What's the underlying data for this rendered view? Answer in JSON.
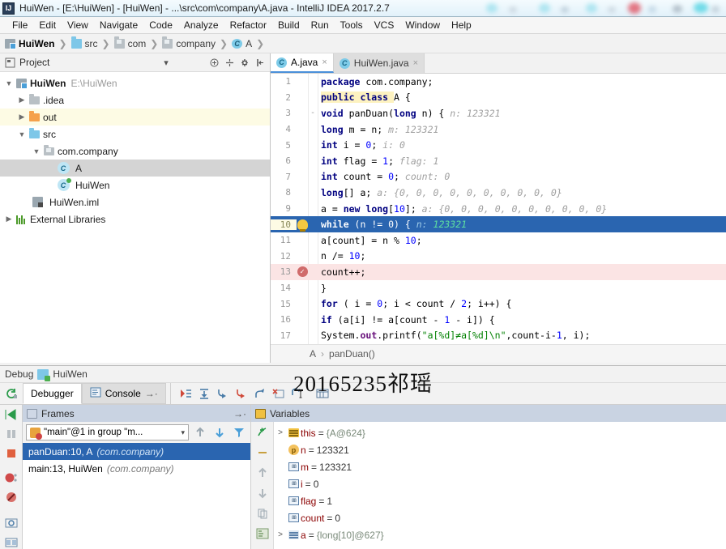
{
  "window": {
    "title": "HuiWen - [E:\\HuiWen] - [HuiWen] - ...\\src\\com\\company\\A.java - IntelliJ IDEA 2017.2.7",
    "app_icon": "IJ"
  },
  "menubar": {
    "items": [
      "File",
      "Edit",
      "View",
      "Navigate",
      "Code",
      "Analyze",
      "Refactor",
      "Build",
      "Run",
      "Tools",
      "VCS",
      "Window",
      "Help"
    ]
  },
  "breadcrumb": {
    "items": [
      {
        "label": "HuiWen",
        "icon": "module-icon"
      },
      {
        "label": "src",
        "icon": "folder-blue-icon"
      },
      {
        "label": "com",
        "icon": "folder-gray-icon"
      },
      {
        "label": "company",
        "icon": "folder-gray-icon"
      },
      {
        "label": "A",
        "icon": "class-icon"
      }
    ]
  },
  "project_panel": {
    "title": "Project",
    "icons": [
      "collapse-all-icon",
      "expand-icon",
      "settings-gear-icon",
      "hide-icon",
      "dropdown-caret-icon"
    ],
    "tree": [
      {
        "label": "HuiWen",
        "sublabel": "E:\\HuiWen",
        "indent": 0,
        "arrow": "v",
        "icon": "module-icon",
        "bold": true,
        "state": "normal"
      },
      {
        "label": ".idea",
        "sublabel": "",
        "indent": 1,
        "arrow": ">",
        "icon": "folder-gray-icon",
        "bold": false,
        "state": "normal"
      },
      {
        "label": "out",
        "sublabel": "",
        "indent": 1,
        "arrow": ">",
        "icon": "folder-orange-icon",
        "bold": false,
        "state": "highlight"
      },
      {
        "label": "src",
        "sublabel": "",
        "indent": 1,
        "arrow": "v",
        "icon": "folder-blue-icon",
        "bold": false,
        "state": "normal"
      },
      {
        "label": "com.company",
        "sublabel": "",
        "indent": 2,
        "arrow": "v",
        "icon": "package-icon",
        "bold": false,
        "state": "normal"
      },
      {
        "label": "A",
        "sublabel": "",
        "indent": 3,
        "arrow": "",
        "icon": "class-icon",
        "bold": false,
        "state": "selected"
      },
      {
        "label": "HuiWen",
        "sublabel": "",
        "indent": 3,
        "arrow": "",
        "icon": "class-run-icon",
        "bold": false,
        "state": "normal"
      },
      {
        "label": "HuiWen.iml",
        "sublabel": "",
        "indent": 1,
        "arrow": "",
        "icon": "iml-file-icon",
        "bold": false,
        "state": "normal"
      },
      {
        "label": "External Libraries",
        "sublabel": "",
        "indent": 0,
        "arrow": ">",
        "icon": "library-icon",
        "bold": false,
        "state": "normal"
      }
    ]
  },
  "editor": {
    "tabs": [
      {
        "label": "A.java",
        "active": true,
        "close": "×",
        "icon": "class-icon"
      },
      {
        "label": "HuiWen.java",
        "active": false,
        "close": "×",
        "icon": "class-run-icon"
      }
    ],
    "breadcrumb": [
      "A",
      "panDuan()"
    ],
    "breadcrumb_sep": "›",
    "lines": [
      {
        "n": "1",
        "fold": "",
        "mark": "",
        "state": "normal",
        "tokens": [
          {
            "t": "package ",
            "c": "kw"
          },
          {
            "t": "com.company;",
            "c": "plain"
          }
        ]
      },
      {
        "n": "2",
        "fold": "",
        "mark": "",
        "state": "normal",
        "tokens": [
          {
            "t": "public class ",
            "c": "kw hl-pub"
          },
          {
            "t": "A {",
            "c": "plain"
          }
        ]
      },
      {
        "n": "3",
        "fold": "-",
        "mark": "",
        "state": "normal",
        "tokens": [
          {
            "t": "    ",
            "c": "plain"
          },
          {
            "t": "void ",
            "c": "kw"
          },
          {
            "t": "panDuan(",
            "c": "plain"
          },
          {
            "t": "long ",
            "c": "kw"
          },
          {
            "t": "n) {",
            "c": "plain"
          },
          {
            "t": "   n:",
            "c": "hint"
          },
          {
            "t": " 123321",
            "c": "hint"
          }
        ]
      },
      {
        "n": "4",
        "fold": "",
        "mark": "",
        "state": "normal",
        "tokens": [
          {
            "t": "        ",
            "c": "plain"
          },
          {
            "t": "long ",
            "c": "kw"
          },
          {
            "t": "m = n;",
            "c": "plain"
          },
          {
            "t": "   m:",
            "c": "hint"
          },
          {
            "t": " 123321",
            "c": "hint"
          }
        ]
      },
      {
        "n": "5",
        "fold": "",
        "mark": "",
        "state": "normal",
        "tokens": [
          {
            "t": "        ",
            "c": "plain"
          },
          {
            "t": "int ",
            "c": "kw"
          },
          {
            "t": "i = ",
            "c": "plain"
          },
          {
            "t": "0",
            "c": "num"
          },
          {
            "t": ";",
            "c": "plain"
          },
          {
            "t": "   i:",
            "c": "hint"
          },
          {
            "t": " 0",
            "c": "hint"
          }
        ]
      },
      {
        "n": "6",
        "fold": "",
        "mark": "",
        "state": "normal",
        "tokens": [
          {
            "t": "        ",
            "c": "plain"
          },
          {
            "t": "int ",
            "c": "kw"
          },
          {
            "t": "flag = ",
            "c": "plain"
          },
          {
            "t": "1",
            "c": "num"
          },
          {
            "t": ";",
            "c": "plain"
          },
          {
            "t": "   flag:",
            "c": "hint"
          },
          {
            "t": " 1",
            "c": "hint"
          }
        ]
      },
      {
        "n": "7",
        "fold": "",
        "mark": "",
        "state": "normal",
        "tokens": [
          {
            "t": "        ",
            "c": "plain"
          },
          {
            "t": "int ",
            "c": "kw"
          },
          {
            "t": "count = ",
            "c": "plain"
          },
          {
            "t": "0",
            "c": "num"
          },
          {
            "t": ";",
            "c": "plain"
          },
          {
            "t": "   count:",
            "c": "hint"
          },
          {
            "t": " 0",
            "c": "hint"
          }
        ]
      },
      {
        "n": "8",
        "fold": "",
        "mark": "",
        "state": "normal",
        "tokens": [
          {
            "t": "        ",
            "c": "plain"
          },
          {
            "t": "long",
            "c": "kw"
          },
          {
            "t": "[] a;",
            "c": "plain"
          },
          {
            "t": "   a:",
            "c": "hint"
          },
          {
            "t": " {0, 0, 0, 0, 0, 0, 0, 0, 0, 0}",
            "c": "hint"
          }
        ]
      },
      {
        "n": "9",
        "fold": "",
        "mark": "",
        "state": "normal",
        "tokens": [
          {
            "t": "        a = ",
            "c": "plain"
          },
          {
            "t": "new long",
            "c": "kw"
          },
          {
            "t": "[",
            "c": "plain"
          },
          {
            "t": "10",
            "c": "num"
          },
          {
            "t": "];",
            "c": "plain"
          },
          {
            "t": "   a:",
            "c": "hint"
          },
          {
            "t": " {0, 0, 0, 0, 0, 0, 0, 0, 0, 0}",
            "c": "hint"
          }
        ]
      },
      {
        "n": "10",
        "fold": "",
        "mark": "bulb",
        "state": "current",
        "tokens": [
          {
            "t": "        ",
            "c": "plain"
          },
          {
            "t": "while ",
            "c": "kw"
          },
          {
            "t": "(n != ",
            "c": "plain"
          },
          {
            "t": "0",
            "c": "num"
          },
          {
            "t": ") {",
            "c": "plain"
          },
          {
            "t": "   n:",
            "c": "hint"
          },
          {
            "t": " 123321",
            "c": "hintv"
          }
        ]
      },
      {
        "n": "11",
        "fold": "",
        "mark": "",
        "state": "normal",
        "tokens": [
          {
            "t": "            a[count] = n % ",
            "c": "plain"
          },
          {
            "t": "10",
            "c": "num"
          },
          {
            "t": ";",
            "c": "plain"
          }
        ]
      },
      {
        "n": "12",
        "fold": "",
        "mark": "",
        "state": "normal",
        "tokens": [
          {
            "t": "            n /= ",
            "c": "plain"
          },
          {
            "t": " 10",
            "c": "num"
          },
          {
            "t": ";",
            "c": "plain"
          }
        ]
      },
      {
        "n": "13",
        "fold": "",
        "mark": "breakpoint",
        "state": "breakpoint",
        "tokens": [
          {
            "t": "            count++;",
            "c": "plain"
          }
        ]
      },
      {
        "n": "14",
        "fold": "",
        "mark": "",
        "state": "normal",
        "tokens": [
          {
            "t": "        }",
            "c": "plain"
          }
        ]
      },
      {
        "n": "15",
        "fold": "",
        "mark": "",
        "state": "normal",
        "tokens": [
          {
            "t": "        ",
            "c": "plain"
          },
          {
            "t": "for ",
            "c": "kw"
          },
          {
            "t": "( i = ",
            "c": "plain"
          },
          {
            "t": "0",
            "c": "num"
          },
          {
            "t": "; i < count / ",
            "c": "plain"
          },
          {
            "t": "2",
            "c": "num"
          },
          {
            "t": "; i++) {",
            "c": "plain"
          }
        ]
      },
      {
        "n": "16",
        "fold": "",
        "mark": "",
        "state": "normal",
        "tokens": [
          {
            "t": "            ",
            "c": "plain"
          },
          {
            "t": "if ",
            "c": "kw"
          },
          {
            "t": "(a[i] != a[count - ",
            "c": "plain"
          },
          {
            "t": "1",
            "c": "num"
          },
          {
            "t": " - i]) {",
            "c": "plain"
          }
        ]
      },
      {
        "n": "17",
        "fold": "",
        "mark": "",
        "state": "normal",
        "tokens": [
          {
            "t": "                System.",
            "c": "plain"
          },
          {
            "t": "out",
            "c": "fld"
          },
          {
            "t": ".printf(",
            "c": "plain"
          },
          {
            "t": "\"a[%d]≠a[%d]\\n\"",
            "c": "str"
          },
          {
            "t": ",count-i-",
            "c": "plain"
          },
          {
            "t": "1",
            "c": "num"
          },
          {
            "t": ", i);",
            "c": "plain"
          }
        ]
      }
    ]
  },
  "watermark": {
    "text": "20165235祁瑶"
  },
  "debug": {
    "title_label": "Debug",
    "config_name": "HuiWen",
    "restart_icon": "rerun-icon",
    "tabs": [
      {
        "label": "Debugger",
        "active": true,
        "icon": ""
      },
      {
        "label": "Console",
        "active": false,
        "icon": "console-icon",
        "suffix": "→·"
      }
    ],
    "step_icons": [
      "show-execution-point-icon",
      "step-over-icon",
      "step-into-icon",
      "force-step-into-icon",
      "step-out-icon",
      "drop-frame-icon",
      "run-to-cursor-icon",
      "evaluate-expression-icon"
    ],
    "left_rail_icons": [
      "resume-program-icon",
      "pause-program-icon",
      "stop-icon",
      "view-breakpoints-icon",
      "mute-breakpoints-icon",
      "settings-icon",
      "layout-icon"
    ],
    "frames": {
      "title": "Frames",
      "hide_icon": "hide-panel-icon",
      "thread_selector": "\"main\"@1 in group \"m...",
      "toolbar_icons": [
        "up-arrow-icon",
        "down-arrow-icon",
        "filter-icon"
      ],
      "rows": [
        {
          "label": "panDuan:10, A",
          "pkg": "(com.company)",
          "selected": true
        },
        {
          "label": "main:13, HuiWen",
          "pkg": "(com.company)",
          "selected": false
        }
      ]
    },
    "variables": {
      "title": "Variables",
      "rail_icons": [
        "add-watch-icon",
        "remove-icon",
        "move-up-icon",
        "move-down-icon",
        "copy-icon",
        "inspect-icon"
      ],
      "rows": [
        {
          "arrow": ">",
          "icon": "object-icon",
          "name": "this",
          "value": "{A@624}",
          "value_class": "ref"
        },
        {
          "arrow": "",
          "icon": "parameter-icon",
          "name": "n",
          "value": "123321",
          "value_class": ""
        },
        {
          "arrow": "",
          "icon": "primitive-icon",
          "name": "m",
          "value": "123321",
          "value_class": ""
        },
        {
          "arrow": "",
          "icon": "primitive-icon",
          "name": "i",
          "value": "0",
          "value_class": ""
        },
        {
          "arrow": "",
          "icon": "primitive-icon",
          "name": "flag",
          "value": "1",
          "value_class": ""
        },
        {
          "arrow": "",
          "icon": "primitive-icon",
          "name": "count",
          "value": "0",
          "value_class": ""
        },
        {
          "arrow": ">",
          "icon": "array-icon",
          "name": "a",
          "value": "{long[10]@627}",
          "value_class": "ref"
        }
      ],
      "equals": "="
    }
  },
  "colors": {
    "accent_blue": "#2a65b0",
    "panel_header": "#c9d3e2",
    "breakpoint_red": "#fbe4e4",
    "keyword": "#000080",
    "string": "#008000",
    "number": "#0000ff"
  }
}
